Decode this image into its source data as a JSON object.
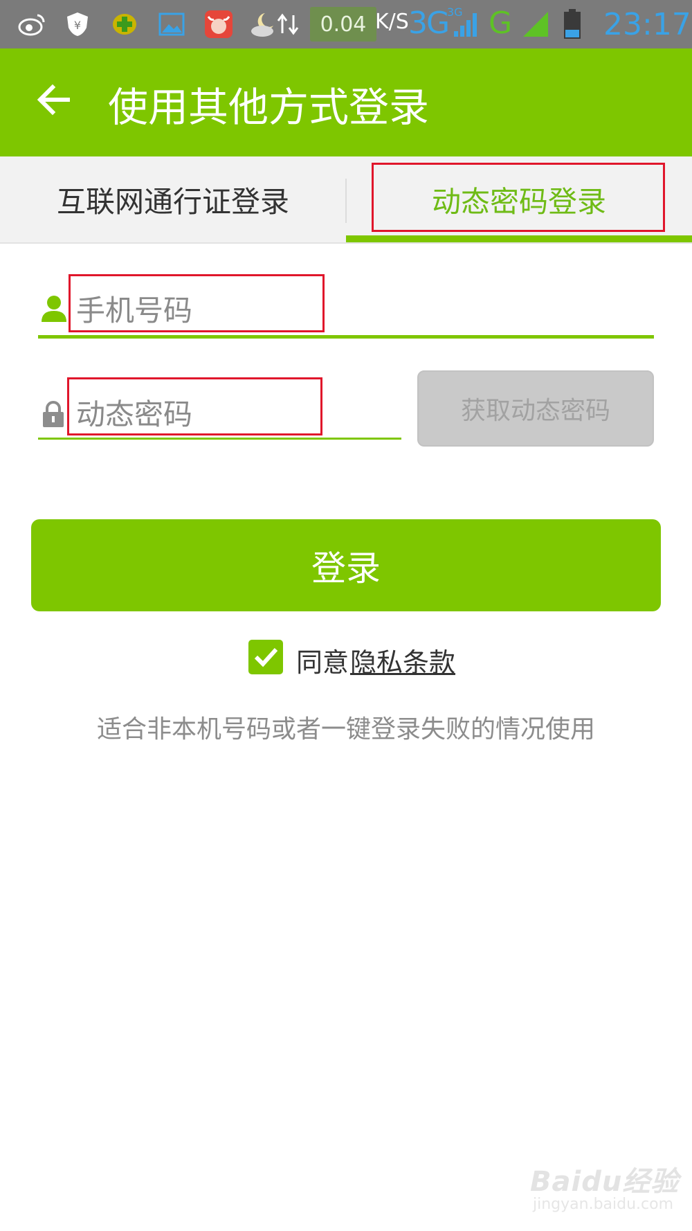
{
  "status_bar": {
    "net_speed": "0.04",
    "net_speed_unit": "K/S",
    "network_3g": "3G",
    "network_3g_sup": "3G",
    "network_g": "G",
    "time": "23:17",
    "icons": [
      "weibo-icon",
      "shield-yuan-icon",
      "plus-icon",
      "image-icon",
      "bull-app-icon",
      "weather-icon",
      "sync-icon",
      "signal-icon",
      "battery-icon"
    ]
  },
  "header": {
    "title": "使用其他方式登录",
    "back_icon": "back-arrow-icon"
  },
  "tabs": [
    {
      "label": "互联网通行证登录",
      "active": false
    },
    {
      "label": "动态密码登录",
      "active": true
    }
  ],
  "form": {
    "phone_placeholder": "手机号码",
    "code_placeholder": "动态密码",
    "get_code_label": "获取动态密码",
    "login_label": "登录"
  },
  "agreement": {
    "checked": true,
    "prefix": "同意",
    "link": "隐私条款"
  },
  "hint": "适合非本机号码或者一键登录失败的情况使用",
  "watermark": {
    "logo": "Baidu经验",
    "url": "jingyan.baidu.com"
  },
  "colors": {
    "brand_green": "#7ec600",
    "highlight_red": "#e0162b",
    "status_bar": "#7b7b7b"
  }
}
